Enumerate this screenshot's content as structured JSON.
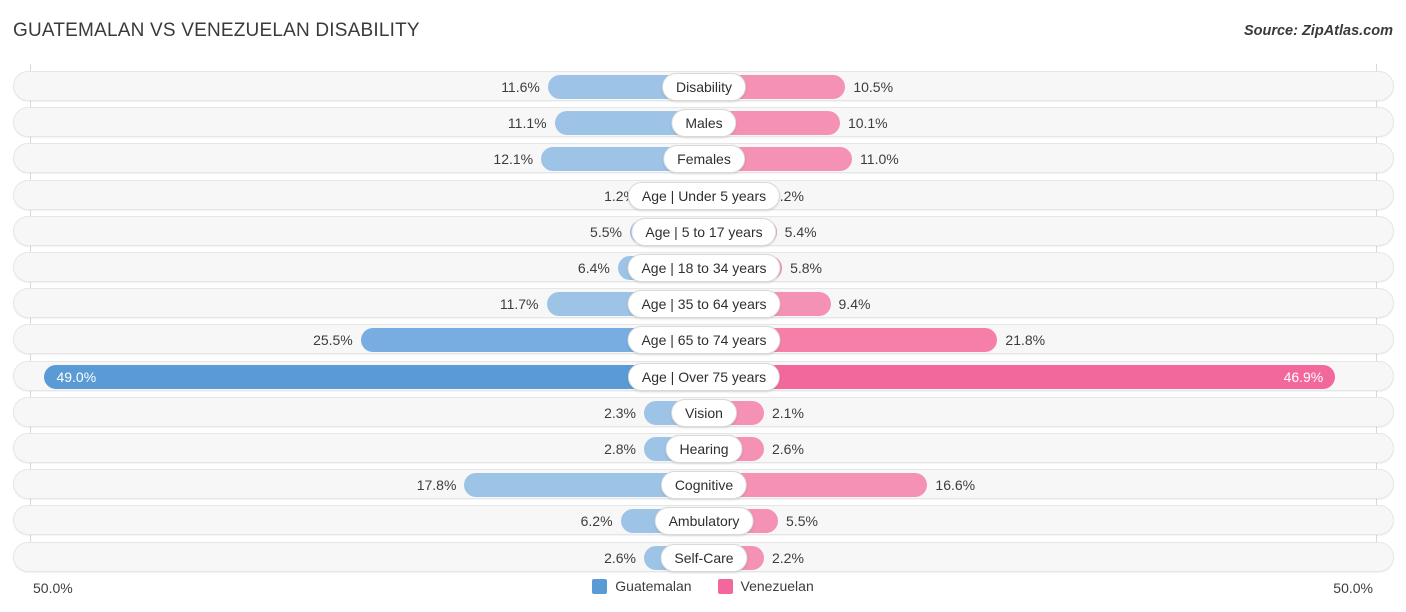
{
  "header": {
    "title": "GUATEMALAN VS VENEZUELAN DISABILITY",
    "source": "Source: ZipAtlas.com"
  },
  "axis": {
    "left_max_label": "50.0%",
    "right_max_label": "50.0%",
    "max_value": 50.0
  },
  "legend": {
    "items": [
      {
        "label": "Guatemalan",
        "color": "#5b9bd5"
      },
      {
        "label": "Venezuelan",
        "color": "#f2689c"
      }
    ]
  },
  "colors": {
    "left_normal": "#9dc3e6",
    "right_normal": "#f491b5",
    "left_highlight": "#5b9bd5",
    "right_highlight": "#f2689c",
    "track": "#f7f7f7",
    "gridline": "#d8d8d8"
  },
  "chart_data": {
    "type": "bar",
    "subtype": "diverging-bidirectional",
    "title": "GUATEMALAN VS VENEZUELAN DISABILITY",
    "xlabel": "",
    "ylabel": "",
    "xlim": [
      -50.0,
      50.0
    ],
    "grid": true,
    "legend_position": "bottom-center",
    "categories": [
      "Disability",
      "Males",
      "Females",
      "Age | Under 5 years",
      "Age | 5 to 17 years",
      "Age | 18 to 34 years",
      "Age | 35 to 64 years",
      "Age | 65 to 74 years",
      "Age | Over 75 years",
      "Vision",
      "Hearing",
      "Cognitive",
      "Ambulatory",
      "Self-Care"
    ],
    "series": [
      {
        "name": "Guatemalan",
        "color": "#5b9bd5",
        "direction": "left",
        "values": [
          11.6,
          11.1,
          12.1,
          1.2,
          5.5,
          6.4,
          11.7,
          25.5,
          49.0,
          2.3,
          2.8,
          17.8,
          6.2,
          2.6
        ],
        "labels": [
          "11.6%",
          "11.1%",
          "12.1%",
          "1.2%",
          "5.5%",
          "6.4%",
          "11.7%",
          "25.5%",
          "49.0%",
          "2.3%",
          "2.8%",
          "17.8%",
          "6.2%",
          "2.6%"
        ]
      },
      {
        "name": "Venezuelan",
        "color": "#f2689c",
        "direction": "right",
        "values": [
          10.5,
          10.1,
          11.0,
          1.2,
          5.4,
          5.8,
          9.4,
          21.8,
          46.9,
          2.1,
          2.6,
          16.6,
          5.5,
          2.2
        ],
        "labels": [
          "10.5%",
          "10.1%",
          "11.0%",
          "1.2%",
          "5.4%",
          "5.8%",
          "9.4%",
          "21.8%",
          "46.9%",
          "2.1%",
          "2.6%",
          "16.6%",
          "5.5%",
          "2.2%"
        ]
      }
    ],
    "emphasis": {
      "highlight_rows": [
        8
      ],
      "semi_rows": [
        7
      ]
    }
  }
}
